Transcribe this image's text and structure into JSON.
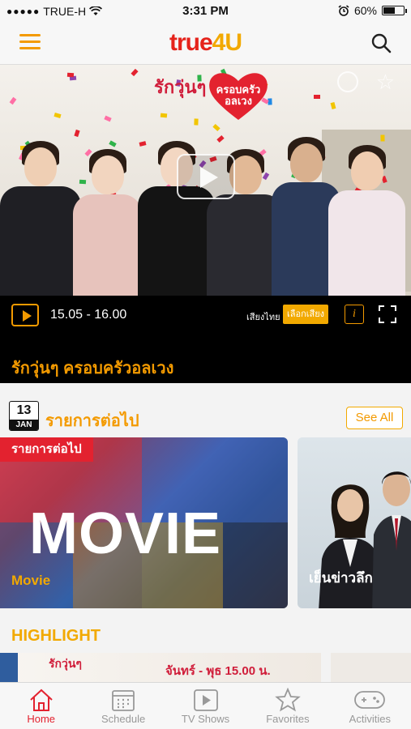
{
  "status_bar": {
    "carrier": "TRUE-H",
    "time": "3:31 PM",
    "battery": "60%",
    "battery_level": 0.6
  },
  "header": {
    "logo_main": "true",
    "logo_accent": "4U"
  },
  "hero": {
    "title": "รักวุ่นๆ",
    "heart_text": "ครอบครัวอลเวง"
  },
  "player": {
    "time_range": "15.05 - 16.00",
    "sound_label": "เสียงไทย",
    "sound_button": "เลือกเสียง",
    "info_label": "i",
    "show_title": "รักวุ่นๆ ครอบครัวอลเวง"
  },
  "upcoming": {
    "date_day": "13",
    "date_month": "JAN",
    "title": "รายการต่อไป",
    "see_all": "See All",
    "cards": [
      {
        "badge": "รายการต่อไป",
        "big_text": "MOVIE",
        "label": "Movie"
      },
      {
        "label": "เย็นข่าวลึก"
      }
    ]
  },
  "highlight": {
    "title": "HIGHLIGHT",
    "card_title": "รักวุ่นๆ",
    "card_time": "จันทร์ - พุธ 15.00 น."
  },
  "tabs": [
    {
      "label": "Home",
      "icon": "home-icon",
      "active": true
    },
    {
      "label": "Schedule",
      "icon": "calendar-icon",
      "active": false
    },
    {
      "label": "TV Shows",
      "icon": "play-icon",
      "active": false
    },
    {
      "label": "Favorites",
      "icon": "star-icon",
      "active": false
    },
    {
      "label": "Activities",
      "icon": "gamepad-icon",
      "active": false
    }
  ],
  "colors": {
    "accent_orange": "#f39a00",
    "brand_red": "#e3222f",
    "player_bg": "#000000"
  }
}
